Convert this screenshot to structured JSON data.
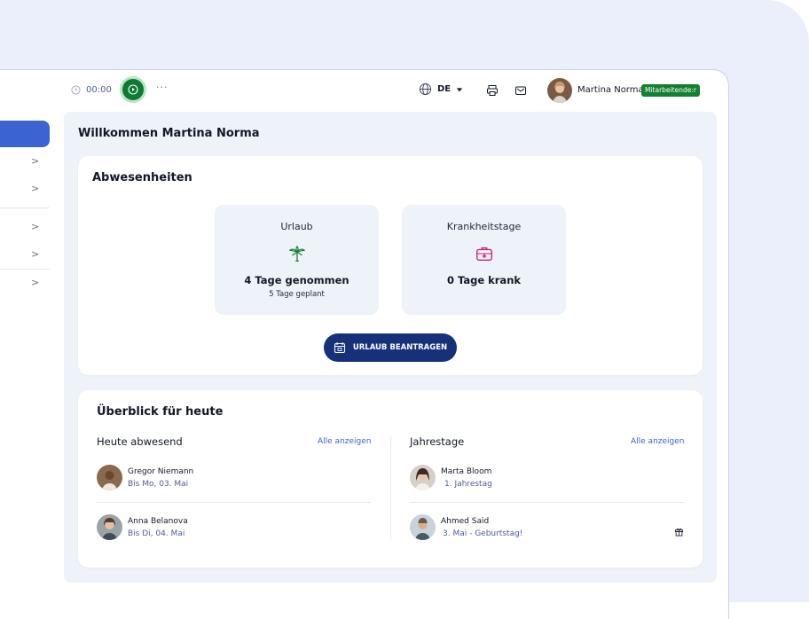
{
  "topbar": {
    "timer": "00:00",
    "more": "···",
    "language": "DE",
    "user_name": "Martina Norma",
    "role_badge": "Mitarbeitende:r"
  },
  "sidebar": {
    "chevrons": [
      ">",
      ">",
      ">",
      ">",
      ">"
    ]
  },
  "main": {
    "welcome": "Willkommen Martina Norma",
    "absences": {
      "title": "Abwesenheiten",
      "vacation": {
        "label": "Urlaub",
        "value": "4 Tage genommen",
        "sub": "5 Tage geplant",
        "icon": "palm-tree-icon"
      },
      "sick": {
        "label": "Krankheitstage",
        "value": "0 Tage krank",
        "icon": "medical-kit-icon"
      },
      "request_button": "URLAUB BEANTRAGEN"
    },
    "overview": {
      "title": "Überblick für heute",
      "absent": {
        "title": "Heute abwesend",
        "link": "Alle anzeigen",
        "people": [
          {
            "name": "Gregor Niemann",
            "sub": "Bis Mo, 03. Mai"
          },
          {
            "name": "Anna Belanova",
            "sub": "Bis Di, 04. Mai"
          }
        ]
      },
      "anniversaries": {
        "title": "Jahrestage",
        "link": "Alle anzeigen",
        "people": [
          {
            "name": "Marta Bloom",
            "sub": "1. Jahrestag"
          },
          {
            "name": "Ahmed Said",
            "sub": "3. Mai - Geburtstag!"
          }
        ]
      }
    }
  },
  "colors": {
    "primary": "#16307a",
    "accent": "#3b63d1",
    "success": "#12802f",
    "sick_icon": "#c0267a"
  }
}
